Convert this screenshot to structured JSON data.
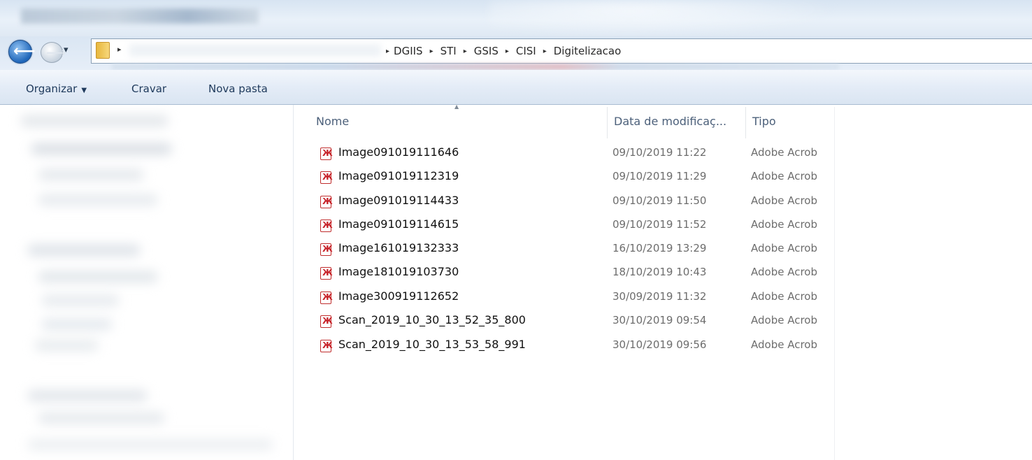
{
  "window": {
    "breadcrumbs": [
      "DGIIS",
      "STI",
      "GSIS",
      "CISI",
      "Digitelizacao"
    ]
  },
  "toolbar": {
    "organize_label": "Organizar",
    "burn_label": "Cravar",
    "new_folder_label": "Nova pasta"
  },
  "columns": {
    "name": "Nome",
    "date": "Data de modificaç...",
    "type": "Tipo"
  },
  "files": [
    {
      "name": "Image091019111646",
      "date": "09/10/2019 11:22",
      "type": "Adobe Acrob"
    },
    {
      "name": "Image091019112319",
      "date": "09/10/2019 11:29",
      "type": "Adobe Acrob"
    },
    {
      "name": "Image091019114433",
      "date": "09/10/2019 11:50",
      "type": "Adobe Acrob"
    },
    {
      "name": "Image091019114615",
      "date": "09/10/2019 11:52",
      "type": "Adobe Acrob"
    },
    {
      "name": "Image161019132333",
      "date": "16/10/2019 13:29",
      "type": "Adobe Acrob"
    },
    {
      "name": "Image181019103730",
      "date": "18/10/2019 10:43",
      "type": "Adobe Acrob"
    },
    {
      "name": "Image300919112652",
      "date": "30/09/2019 11:32",
      "type": "Adobe Acrob"
    },
    {
      "name": "Scan_2019_10_30_13_52_35_800",
      "date": "30/10/2019 09:54",
      "type": "Adobe Acrob"
    },
    {
      "name": "Scan_2019_10_30_13_53_58_991",
      "date": "30/10/2019 09:56",
      "type": "Adobe Acrob"
    }
  ],
  "icons": {
    "file": "pdf-file-icon",
    "back": "back-arrow-icon",
    "forward": "forward-arrow-icon",
    "folder": "folder-icon"
  },
  "colors": {
    "pdf_red": "#c7232a",
    "toolbar_text": "#1e395b"
  }
}
